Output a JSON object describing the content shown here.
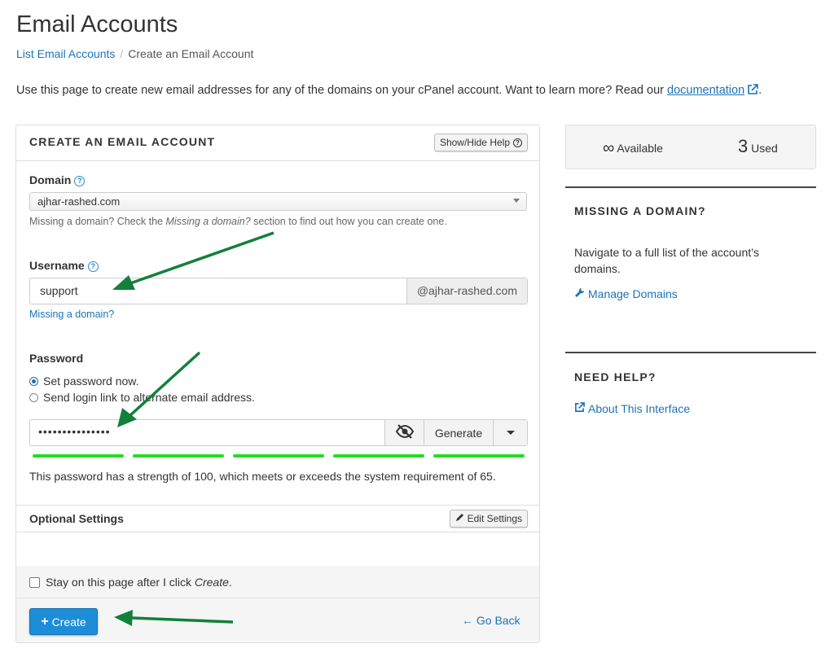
{
  "page": {
    "title": "Email Accounts",
    "breadcrumb": {
      "link": "List Email Accounts",
      "current": "Create an Email Account"
    },
    "intro": "Use this page to create new email addresses for any of the domains on your cPanel account. Want to learn more? Read our ",
    "intro_link": "documentation",
    "intro_end": "."
  },
  "form": {
    "header": "CREATE AN EMAIL ACCOUNT",
    "show_hide_help": "Show/Hide Help",
    "domain_label": "Domain",
    "domain_value": "ajhar-rashed.com",
    "domain_hint_pre": "Missing a domain? Check the ",
    "domain_hint_em": "Missing a domain?",
    "domain_hint_post": " section to find out how you can create one.",
    "username_label": "Username",
    "username_value": "support",
    "username_suffix": "@ajhar-rashed.com",
    "missing_domain_link": "Missing a domain?",
    "password_label": "Password",
    "radio_set_now": "Set password now.",
    "radio_send_link": "Send login link to alternate email address.",
    "password_value": "•••••••••••••••",
    "generate_label": "Generate",
    "password_strength": 100,
    "strength_text": "This password has a strength of 100, which meets or exceeds the system requirement of 65.",
    "optional_settings": "Optional Settings",
    "edit_settings": "Edit Settings",
    "stay_label_pre": "Stay on this page after I click ",
    "stay_label_em": "Create",
    "stay_label_post": ".",
    "create_label": "Create",
    "go_back_label": "Go Back"
  },
  "sidebar": {
    "available_symbol": "∞",
    "available_label": "Available",
    "used_count": "3",
    "used_label": "Used",
    "missing_domain_title": "MISSING A DOMAIN?",
    "missing_domain_text": "Navigate to a full list of the account’s domains.",
    "manage_domains": "Manage Domains",
    "need_help_title": "NEED HELP?",
    "about_interface": "About This Interface"
  },
  "colors": {
    "link": "#1b73b7",
    "primary_button": "#1d8dd8",
    "strength_bar": "#22dd22",
    "annotation_arrow": "#12803a"
  }
}
